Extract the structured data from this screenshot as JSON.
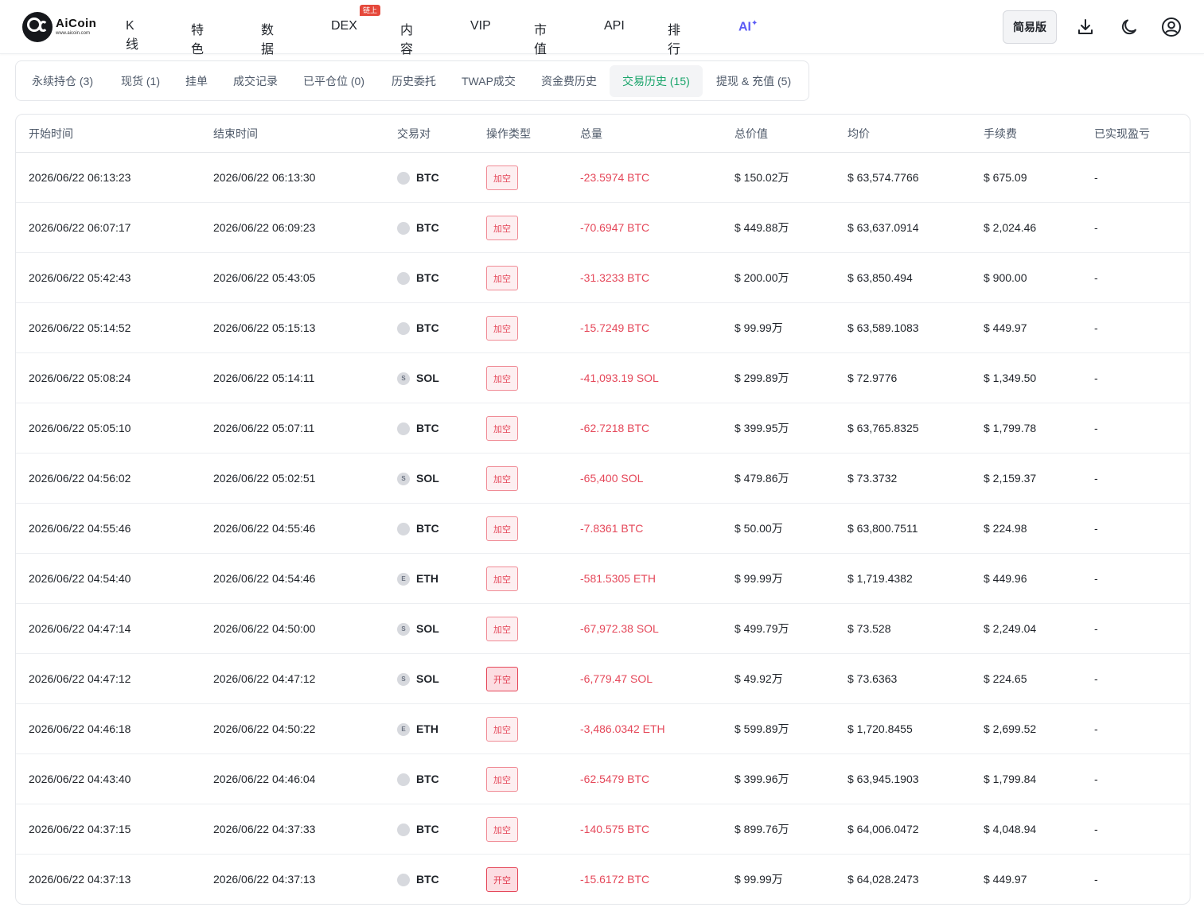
{
  "header": {
    "logo_name": "AiCoin",
    "logo_url": "www.aicoin.com",
    "nav": [
      {
        "label": "K线",
        "badge": ""
      },
      {
        "label": "特色",
        "badge": ""
      },
      {
        "label": "数据",
        "badge": ""
      },
      {
        "label": "DEX",
        "badge": "链上"
      },
      {
        "label": "内容",
        "badge": ""
      },
      {
        "label": "VIP",
        "badge": ""
      },
      {
        "label": "市值",
        "badge": ""
      },
      {
        "label": "API",
        "badge": ""
      },
      {
        "label": "排行",
        "badge": ""
      }
    ],
    "ai_label": "AI",
    "ai_mark": "✦",
    "simple_mode": "简易版",
    "accent": "#5b5bf5"
  },
  "tabs": [
    {
      "label": "永续持仓 (3)",
      "active": false
    },
    {
      "label": "现货 (1)",
      "active": false
    },
    {
      "label": "挂单",
      "active": false
    },
    {
      "label": "成交记录",
      "active": false
    },
    {
      "label": "已平仓位 (0)",
      "active": false
    },
    {
      "label": "历史委托",
      "active": false
    },
    {
      "label": "TWAP成交",
      "active": false
    },
    {
      "label": "资金费历史",
      "active": false
    },
    {
      "label": "交易历史 (15)",
      "active": true
    },
    {
      "label": "提现 & 充值 (5)",
      "active": false
    }
  ],
  "table": {
    "columns": [
      "开始时间",
      "结束时间",
      "交易对",
      "操作类型",
      "总量",
      "总价值",
      "均价",
      "手续费",
      "已实现盈亏"
    ],
    "rows": [
      {
        "start": "2026/06/22 06:13:23",
        "end": "2026/06/22 06:13:30",
        "coin": "BTC",
        "coin_icon": "",
        "op": "加空",
        "op_type": "add",
        "amount": "-23.5974 BTC",
        "value": "$ 150.02万",
        "avg": "$ 63,574.7766",
        "fee": "$ 675.09",
        "pnl": "-"
      },
      {
        "start": "2026/06/22 06:07:17",
        "end": "2026/06/22 06:09:23",
        "coin": "BTC",
        "coin_icon": "",
        "op": "加空",
        "op_type": "add",
        "amount": "-70.6947 BTC",
        "value": "$ 449.88万",
        "avg": "$ 63,637.0914",
        "fee": "$ 2,024.46",
        "pnl": "-"
      },
      {
        "start": "2026/06/22 05:42:43",
        "end": "2026/06/22 05:43:05",
        "coin": "BTC",
        "coin_icon": "",
        "op": "加空",
        "op_type": "add",
        "amount": "-31.3233 BTC",
        "value": "$ 200.00万",
        "avg": "$ 63,850.494",
        "fee": "$ 900.00",
        "pnl": "-"
      },
      {
        "start": "2026/06/22 05:14:52",
        "end": "2026/06/22 05:15:13",
        "coin": "BTC",
        "coin_icon": "",
        "op": "加空",
        "op_type": "add",
        "amount": "-15.7249 BTC",
        "value": "$ 99.99万",
        "avg": "$ 63,589.1083",
        "fee": "$ 449.97",
        "pnl": "-"
      },
      {
        "start": "2026/06/22 05:08:24",
        "end": "2026/06/22 05:14:11",
        "coin": "SOL",
        "coin_icon": "S",
        "op": "加空",
        "op_type": "add",
        "amount": "-41,093.19 SOL",
        "value": "$ 299.89万",
        "avg": "$ 72.9776",
        "fee": "$ 1,349.50",
        "pnl": "-"
      },
      {
        "start": "2026/06/22 05:05:10",
        "end": "2026/06/22 05:07:11",
        "coin": "BTC",
        "coin_icon": "",
        "op": "加空",
        "op_type": "add",
        "amount": "-62.7218 BTC",
        "value": "$ 399.95万",
        "avg": "$ 63,765.8325",
        "fee": "$ 1,799.78",
        "pnl": "-"
      },
      {
        "start": "2026/06/22 04:56:02",
        "end": "2026/06/22 05:02:51",
        "coin": "SOL",
        "coin_icon": "S",
        "op": "加空",
        "op_type": "add",
        "amount": "-65,400 SOL",
        "value": "$ 479.86万",
        "avg": "$ 73.3732",
        "fee": "$ 2,159.37",
        "pnl": "-"
      },
      {
        "start": "2026/06/22 04:55:46",
        "end": "2026/06/22 04:55:46",
        "coin": "BTC",
        "coin_icon": "",
        "op": "加空",
        "op_type": "add",
        "amount": "-7.8361 BTC",
        "value": "$ 50.00万",
        "avg": "$ 63,800.7511",
        "fee": "$ 224.98",
        "pnl": "-"
      },
      {
        "start": "2026/06/22 04:54:40",
        "end": "2026/06/22 04:54:46",
        "coin": "ETH",
        "coin_icon": "E",
        "op": "加空",
        "op_type": "add",
        "amount": "-581.5305 ETH",
        "value": "$ 99.99万",
        "avg": "$ 1,719.4382",
        "fee": "$ 449.96",
        "pnl": "-"
      },
      {
        "start": "2026/06/22 04:47:14",
        "end": "2026/06/22 04:50:00",
        "coin": "SOL",
        "coin_icon": "S",
        "op": "加空",
        "op_type": "add",
        "amount": "-67,972.38 SOL",
        "value": "$ 499.79万",
        "avg": "$ 73.528",
        "fee": "$ 2,249.04",
        "pnl": "-"
      },
      {
        "start": "2026/06/22 04:47:12",
        "end": "2026/06/22 04:47:12",
        "coin": "SOL",
        "coin_icon": "S",
        "op": "开空",
        "op_type": "open",
        "amount": "-6,779.47 SOL",
        "value": "$ 49.92万",
        "avg": "$ 73.6363",
        "fee": "$ 224.65",
        "pnl": "-"
      },
      {
        "start": "2026/06/22 04:46:18",
        "end": "2026/06/22 04:50:22",
        "coin": "ETH",
        "coin_icon": "E",
        "op": "加空",
        "op_type": "add",
        "amount": "-3,486.0342 ETH",
        "value": "$ 599.89万",
        "avg": "$ 1,720.8455",
        "fee": "$ 2,699.52",
        "pnl": "-"
      },
      {
        "start": "2026/06/22 04:43:40",
        "end": "2026/06/22 04:46:04",
        "coin": "BTC",
        "coin_icon": "",
        "op": "加空",
        "op_type": "add",
        "amount": "-62.5479 BTC",
        "value": "$ 399.96万",
        "avg": "$ 63,945.1903",
        "fee": "$ 1,799.84",
        "pnl": "-"
      },
      {
        "start": "2026/06/22 04:37:15",
        "end": "2026/06/22 04:37:33",
        "coin": "BTC",
        "coin_icon": "",
        "op": "加空",
        "op_type": "add",
        "amount": "-140.575 BTC",
        "value": "$ 899.76万",
        "avg": "$ 64,006.0472",
        "fee": "$ 4,048.94",
        "pnl": "-"
      },
      {
        "start": "2026/06/22 04:37:13",
        "end": "2026/06/22 04:37:13",
        "coin": "BTC",
        "coin_icon": "",
        "op": "开空",
        "op_type": "open",
        "amount": "-15.6172 BTC",
        "value": "$ 99.99万",
        "avg": "$ 64,028.2473",
        "fee": "$ 449.97",
        "pnl": "-"
      }
    ]
  },
  "colors": {
    "active_tab": "#1aa56b",
    "negative": "#e5485a"
  },
  "icons": [
    "download-icon",
    "moon-icon",
    "user-icon"
  ]
}
